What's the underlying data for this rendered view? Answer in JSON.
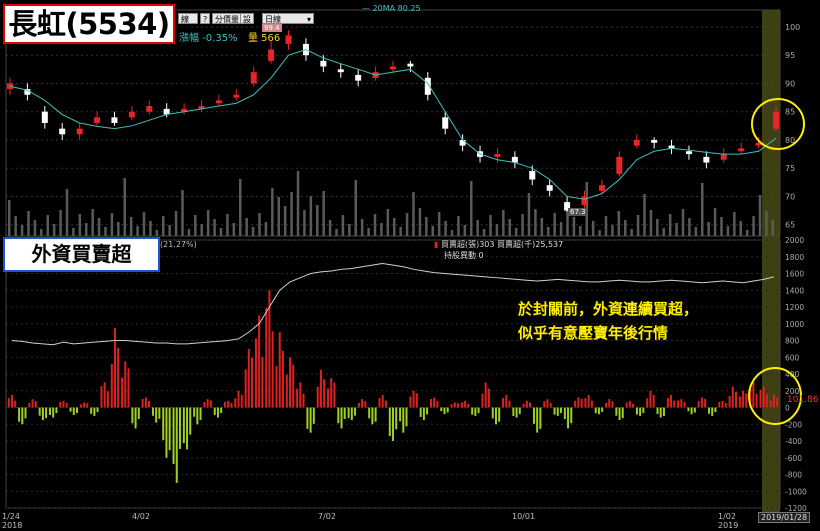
{
  "title": "長虹(5534)",
  "subtitle": "外資買賣超",
  "toolbar": {
    "indicator_btn": "線降",
    "num_btn": "?",
    "share_btn": "分價量",
    "settings_btn": "設",
    "period_select": "日線"
  },
  "header": {
    "ma_label": "20MA 80.25",
    "change_text": "漲幅 -0.35%",
    "volume_text": "量 566",
    "lower_pct": "(21.27%)",
    "net_label": "買賣超(張)303 買賣超(千)25,537",
    "holding_label": "持股異動 0"
  },
  "annotation": {
    "line1": "於封關前，外資連續買超，",
    "line2": "似乎有意壓寶年後行情"
  },
  "price_labels": {
    "high": "99.4",
    "low": "67.3"
  },
  "current_value": "101.86",
  "highlight_date": "2019/01/28",
  "colors": {
    "up": "#e8262a",
    "down": "#ffffff",
    "ma": "#3fc0c0",
    "buy": "#e02020",
    "sell": "#a0d020",
    "holding": "#cfcfcf",
    "annotation": "#ffee00",
    "highlight": "#4a4a18",
    "circle": "#ffee00"
  },
  "chart_data": [
    {
      "type": "candlestick",
      "title": "長虹(5534)",
      "ylim": [
        63,
        103
      ],
      "yticks": [
        65,
        70,
        75,
        80,
        85,
        90,
        95,
        100
      ],
      "x_tick_labels": [
        "1/24 2018",
        "4/02",
        "7/02",
        "10/01",
        "1/02 2019"
      ],
      "series": [
        {
          "name": "20MA",
          "values": [
            89.5,
            88.8,
            87.0,
            84.5,
            83.0,
            82.4,
            82.0,
            82.5,
            83.5,
            84.5,
            85.0,
            85.5,
            86.0,
            86.5,
            88.0,
            91.0,
            95.0,
            96.0,
            94.5,
            93.5,
            92.5,
            91.5,
            92.0,
            92.5,
            90.0,
            85.0,
            80.0,
            77.5,
            76.5,
            76.0,
            75.0,
            73.0,
            70.0,
            69.5,
            70.5,
            73.0,
            76.5,
            78.0,
            78.5,
            78.2,
            77.8,
            77.5,
            77.5,
            78.0,
            80.3
          ]
        },
        {
          "name": "close",
          "values": [
            90.0,
            88.0,
            83.0,
            81.0,
            82.0,
            84.0,
            83.0,
            85.0,
            86.0,
            84.5,
            85.5,
            86.0,
            87.0,
            88.0,
            92.0,
            96.0,
            98.5,
            95.0,
            93.0,
            92.0,
            90.5,
            92.0,
            93.0,
            93.0,
            88.0,
            82.0,
            79.0,
            77.0,
            77.5,
            76.0,
            73.0,
            71.0,
            67.5,
            70.0,
            72.0,
            77.0,
            80.0,
            79.5,
            78.5,
            77.5,
            76.0,
            77.5,
            78.5,
            79.5,
            85.0
          ]
        },
        {
          "name": "open",
          "values": [
            89.0,
            89.0,
            85.0,
            82.0,
            81.0,
            83.0,
            84.0,
            84.0,
            85.0,
            85.5,
            85.0,
            85.5,
            86.5,
            87.5,
            90.0,
            94.0,
            97.0,
            97.0,
            94.0,
            92.5,
            91.5,
            91.0,
            92.5,
            93.5,
            91.0,
            84.0,
            80.0,
            78.0,
            77.0,
            77.0,
            74.5,
            72.0,
            69.0,
            68.5,
            71.0,
            74.0,
            79.0,
            80.0,
            79.0,
            78.0,
            77.0,
            76.5,
            78.0,
            79.0,
            82.0
          ]
        },
        {
          "name": "high",
          "values": [
            91.0,
            90.0,
            86.0,
            83.0,
            83.0,
            85.0,
            85.0,
            86.0,
            87.0,
            86.5,
            86.5,
            87.0,
            88.0,
            89.0,
            93.0,
            97.5,
            99.4,
            98.0,
            95.0,
            93.5,
            92.5,
            93.0,
            94.0,
            94.0,
            92.0,
            85.0,
            81.0,
            79.0,
            78.5,
            78.0,
            75.5,
            73.0,
            70.0,
            71.0,
            73.0,
            78.0,
            81.0,
            80.5,
            80.0,
            79.0,
            78.0,
            78.5,
            79.5,
            80.5,
            86.0
          ]
        },
        {
          "name": "low",
          "values": [
            88.0,
            87.0,
            82.0,
            80.0,
            80.0,
            82.5,
            82.5,
            83.5,
            84.5,
            84.0,
            84.5,
            85.0,
            86.0,
            87.0,
            89.5,
            93.5,
            96.0,
            94.0,
            92.0,
            91.0,
            89.5,
            90.5,
            92.0,
            92.0,
            87.0,
            81.0,
            78.0,
            76.0,
            76.0,
            75.0,
            72.0,
            70.0,
            67.3,
            68.0,
            70.5,
            73.5,
            78.5,
            78.5,
            77.5,
            76.5,
            75.0,
            76.0,
            77.5,
            78.5,
            81.5
          ]
        }
      ]
    },
    {
      "type": "bar",
      "title": "外資買賣超",
      "ylim": [
        -1200,
        2000
      ],
      "yticks": [
        -1200,
        -1000,
        -800,
        -600,
        -400,
        -200,
        0,
        200,
        400,
        600,
        800,
        1000,
        1200,
        1400,
        1600,
        1800,
        2000
      ],
      "series": [
        {
          "name": "買賣超(張)",
          "values": [
            150,
            -200,
            100,
            -150,
            -120,
            80,
            -90,
            60,
            -100,
            300,
            950,
            550,
            -250,
            120,
            -180,
            -600,
            -900,
            -500,
            -200,
            100,
            -120,
            80,
            200,
            700,
            1100,
            1400,
            900,
            600,
            300,
            -300,
            450,
            350,
            -250,
            -150,
            100,
            -200,
            150,
            -400,
            -300,
            200,
            -150,
            120,
            -80,
            60,
            80,
            -100,
            300,
            -200,
            150,
            -120,
            80,
            -300,
            100,
            -100,
            -250,
            120,
            150,
            -80,
            100,
            -150,
            80,
            -100,
            200,
            -120,
            150,
            100,
            -80,
            120,
            -100,
            80,
            250,
            200,
            300,
            250,
            150
          ]
        },
        {
          "name": "持股",
          "values": [
            800,
            790,
            770,
            760,
            750,
            780,
            760,
            770,
            780,
            790,
            800,
            800,
            790,
            780,
            770,
            770,
            760,
            760,
            770,
            780,
            790,
            800,
            820,
            900,
            1000,
            1200,
            1400,
            1500,
            1550,
            1600,
            1620,
            1630,
            1650,
            1660,
            1680,
            1700,
            1720,
            1700,
            1680,
            1650,
            1630,
            1610,
            1600,
            1590,
            1580,
            1570,
            1560,
            1550,
            1540,
            1530,
            1520,
            1510,
            1520,
            1530,
            1520,
            1510,
            1500,
            1500,
            1510,
            1520,
            1510,
            1500,
            1500,
            1510,
            1520,
            1510,
            1500,
            1490,
            1500,
            1510,
            1500,
            1490,
            1510,
            1530,
            1560
          ]
        }
      ]
    }
  ]
}
